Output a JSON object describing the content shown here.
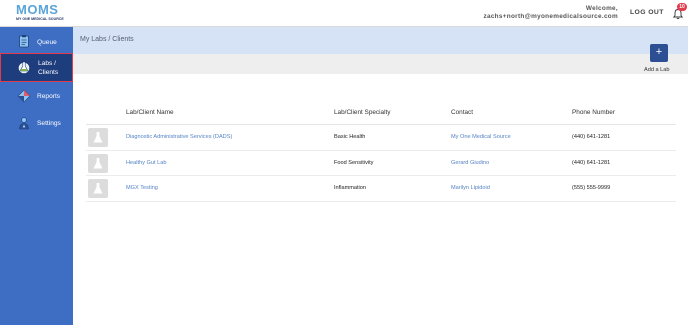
{
  "header": {
    "logo_text": "MOMS",
    "logo_subtext": "MY ONE MEDICAL SOURCE",
    "welcome_label": "Welcome,",
    "user_email": "zachs+north@myonemedicalsource.com",
    "logout_label": "LOG OUT",
    "notification_count": "10"
  },
  "sidebar": {
    "items": [
      {
        "label": "Queue",
        "icon": "clipboard-icon"
      },
      {
        "label_line1": "Labs /",
        "label_line2": "Clients",
        "icon": "flask-icon",
        "active": true
      },
      {
        "label": "Reports",
        "icon": "diamond-chart-icon"
      },
      {
        "label": "Settings",
        "icon": "gear-person-icon"
      }
    ]
  },
  "page": {
    "breadcrumb": "My Labs / Clients",
    "add_button_symbol": "+",
    "add_button_label": "Add a Lab"
  },
  "table": {
    "columns": [
      "Lab/Client Name",
      "Lab/Client Specialty",
      "Contact",
      "Phone Number"
    ],
    "rows": [
      {
        "name": "Diagnostic Administrative Services (DADS)",
        "specialty": "Basic Health",
        "contact": "My One Medical Source",
        "phone": "(440) 641-1281"
      },
      {
        "name": "Healthy Gut Lab",
        "specialty": "Food Sensitivity",
        "contact": "Gerard Giudino",
        "phone": "(440) 641-1281"
      },
      {
        "name": "MGX Testing",
        "specialty": "Inflammation",
        "contact": "Marilyn Lipidoid",
        "phone": "(555) 555-9999"
      }
    ]
  },
  "colors": {
    "sidebar": "#3e6ec4",
    "sidebar_active": "#1d3d7d",
    "active_border": "#e23b4e",
    "subheader": "#d6e2f6",
    "add_button": "#2b4f92",
    "link": "#5583c6"
  }
}
